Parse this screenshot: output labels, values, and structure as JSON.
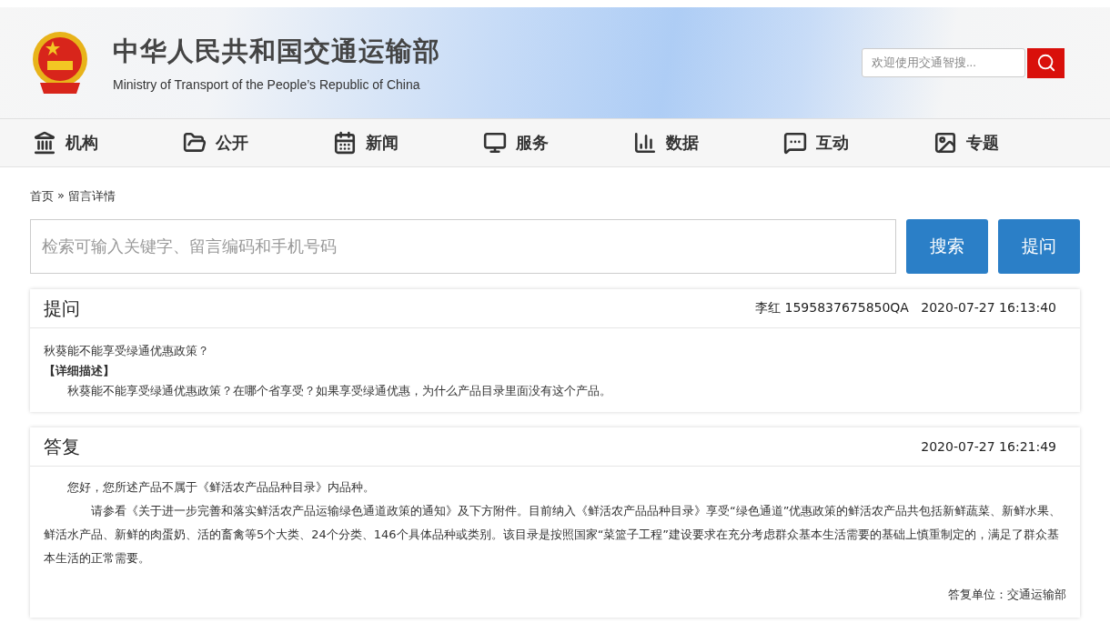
{
  "header": {
    "title": "中华人民共和国交通运输部",
    "subtitle": "Ministry of Transport of the People’s Republic of China",
    "search": {
      "placeholder": "欢迎使用交通智搜..."
    }
  },
  "nav": [
    {
      "label": "机构"
    },
    {
      "label": "公开"
    },
    {
      "label": "新闻"
    },
    {
      "label": "服务"
    },
    {
      "label": "数据"
    },
    {
      "label": "互动"
    },
    {
      "label": "专题"
    }
  ],
  "breadcrumb": {
    "home": "首页",
    "separator": "»",
    "current": "留言详情"
  },
  "search": {
    "placeholder": "检索可输入关键字、留言编码和手机号码",
    "buttons": [
      "搜索",
      "提问"
    ]
  },
  "question": {
    "title": "提问",
    "author": "李红 1595837675850QA",
    "time": "2020-07-27 16:13:40",
    "subject": "秋葵能不能享受绿通优惠政策？",
    "detail_label": "【详细描述】",
    "detail": "秋葵能不能享受绿通优惠政策？在哪个省享受？如果享受绿通优惠，为什么产品目录里面没有这个产品。"
  },
  "answer": {
    "title": "答复",
    "time": "2020-07-27 16:21:49",
    "paragraphs": [
      "您好，您所述产品不属于《鲜活农产品品种目录》内品种。",
      "请参看《关于进一步完善和落实鲜活农产品运输绿色通道政策的通知》及下方附件。目前纳入《鲜活农产品品种目录》享受“绿色通道”优惠政策的鲜活农产品共包括新鲜蔬菜、新鲜水果、鲜活水产品、新鲜的肉蛋奶、活的畜禽等5个大类、24个分类、146个具体品种或类别。该目录是按照国家“菜篮子工程”建设要求在充分考虑群众基本生活需要的基础上慎重制定的，满足了群众基本生活的正常需要。"
    ],
    "unit": "答复单位：交通运输部"
  }
}
